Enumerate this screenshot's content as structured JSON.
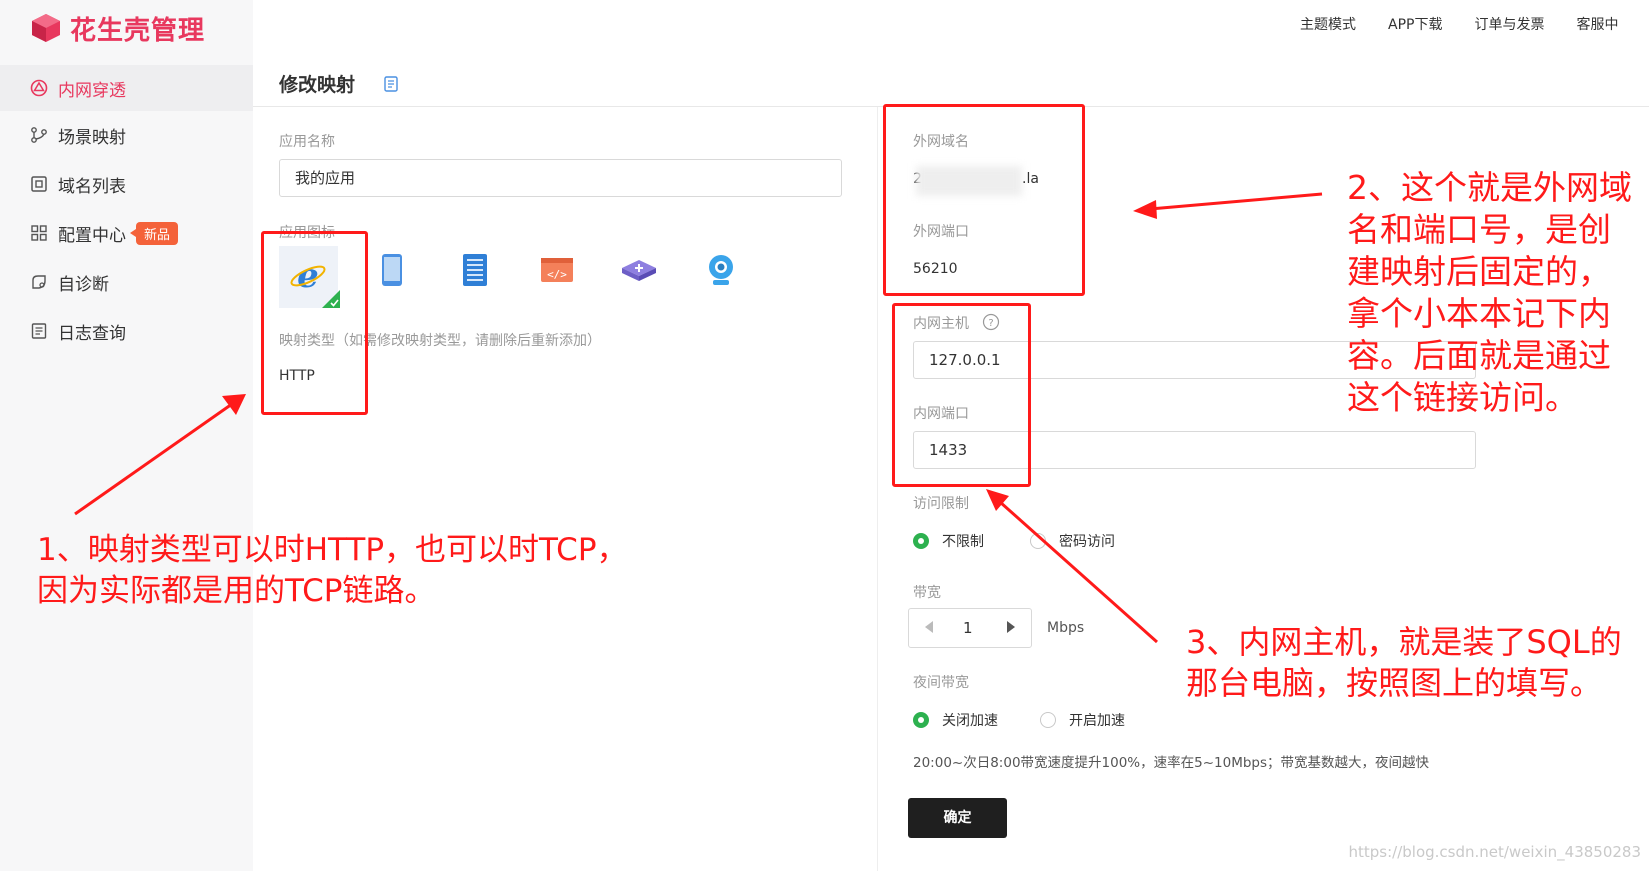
{
  "brand": {
    "name": "花生壳管理",
    "accent": "#e8385e"
  },
  "topnav": [
    "主题模式",
    "APP下载",
    "订单与发票",
    "客服中"
  ],
  "sidebar": {
    "items": [
      {
        "label": "内网穿透",
        "icon": "network-penetration-icon",
        "active": true
      },
      {
        "label": "场景映射",
        "icon": "scene-mapping-icon"
      },
      {
        "label": "域名列表",
        "icon": "domain-list-icon"
      },
      {
        "label": "配置中心",
        "icon": "config-grid-icon",
        "badge": "新品"
      },
      {
        "label": "自诊断",
        "icon": "self-diagnosis-icon"
      },
      {
        "label": "日志查询",
        "icon": "log-query-icon"
      }
    ]
  },
  "page": {
    "title": "修改映射",
    "title_icon": "document-icon"
  },
  "form": {
    "app_name": {
      "label": "应用名称",
      "value": "我的应用"
    },
    "app_icon": {
      "label": "应用图标",
      "icons": [
        "ie-icon",
        "phone-icon",
        "server-icon",
        "code-icon",
        "router-icon",
        "webcam-icon"
      ],
      "selected": "ie-icon"
    },
    "mapping_type": {
      "label": "映射类型（如需修改映射类型，请删除后重新添加）",
      "value": "HTTP"
    },
    "external_domain": {
      "label": "外网域名",
      "value_prefix": "2",
      "value_suffix": ".la"
    },
    "external_port": {
      "label": "外网端口",
      "value": "56210"
    },
    "internal_host": {
      "label": "内网主机",
      "value": "127.0.0.1",
      "help_icon": "question-circle-icon"
    },
    "internal_port": {
      "label": "内网端口",
      "value": "1433"
    },
    "access_limit": {
      "label": "访问限制",
      "options": [
        "不限制",
        "密码访问"
      ],
      "selected": "不限制"
    },
    "bandwidth": {
      "label": "带宽",
      "value": "1",
      "unit": "Mbps"
    },
    "night_bandwidth": {
      "label": "夜间带宽",
      "options": [
        "关闭加速",
        "开启加速"
      ],
      "selected": "关闭加速",
      "note": "20:00~次日8:00带宽速度提升100%，速率在5~10Mbps；带宽基数越大，夜间越快"
    },
    "confirm_label": "确定"
  },
  "annotations": {
    "a1": [
      "1、映射类型可以时HTTP，也可以时TCP，",
      "因为实际都是用的TCP链路。"
    ],
    "a2": [
      "2、这个就是外网域",
      "名和端口号，是创",
      "建映射后固定的，",
      "拿个小本本记下内",
      "容。后面就是通过",
      "这个链接访问。"
    ],
    "a3": [
      "3、内网主机，就是装了SQL的",
      "那台电脑，按照图上的填写。"
    ],
    "color": "#ff1a1a"
  },
  "watermark": "https://blog.csdn.net/weixin_43850283"
}
